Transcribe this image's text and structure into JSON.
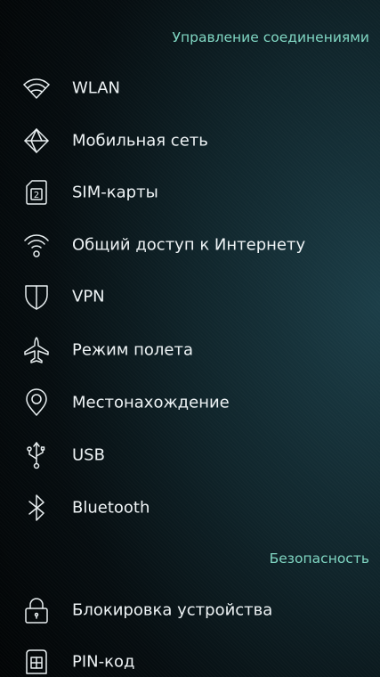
{
  "sections": {
    "connections": {
      "title": "Управление соединениями",
      "items": [
        {
          "label": "WLAN",
          "icon": "wifi-icon"
        },
        {
          "label": "Мобильная сеть",
          "icon": "mobile-network-icon"
        },
        {
          "label": "SIM-карты",
          "icon": "sim-card-icon"
        },
        {
          "label": "Общий доступ к Интернету",
          "icon": "internet-sharing-icon"
        },
        {
          "label": "VPN",
          "icon": "shield-icon"
        },
        {
          "label": "Режим полета",
          "icon": "airplane-icon"
        },
        {
          "label": "Местонахождение",
          "icon": "location-pin-icon"
        },
        {
          "label": "USB",
          "icon": "usb-icon"
        },
        {
          "label": "Bluetooth",
          "icon": "bluetooth-icon"
        }
      ]
    },
    "security": {
      "title": "Безопасность",
      "items": [
        {
          "label": "Блокировка устройства",
          "icon": "lock-icon"
        },
        {
          "label": "PIN-код",
          "icon": "pin-code-icon"
        }
      ]
    }
  },
  "sim_icon_number": "2",
  "colors": {
    "section_header": "#7fd6c2",
    "item_text": "#eef3f5",
    "background_dark": "#020405",
    "background_accent": "#1c3e48"
  }
}
